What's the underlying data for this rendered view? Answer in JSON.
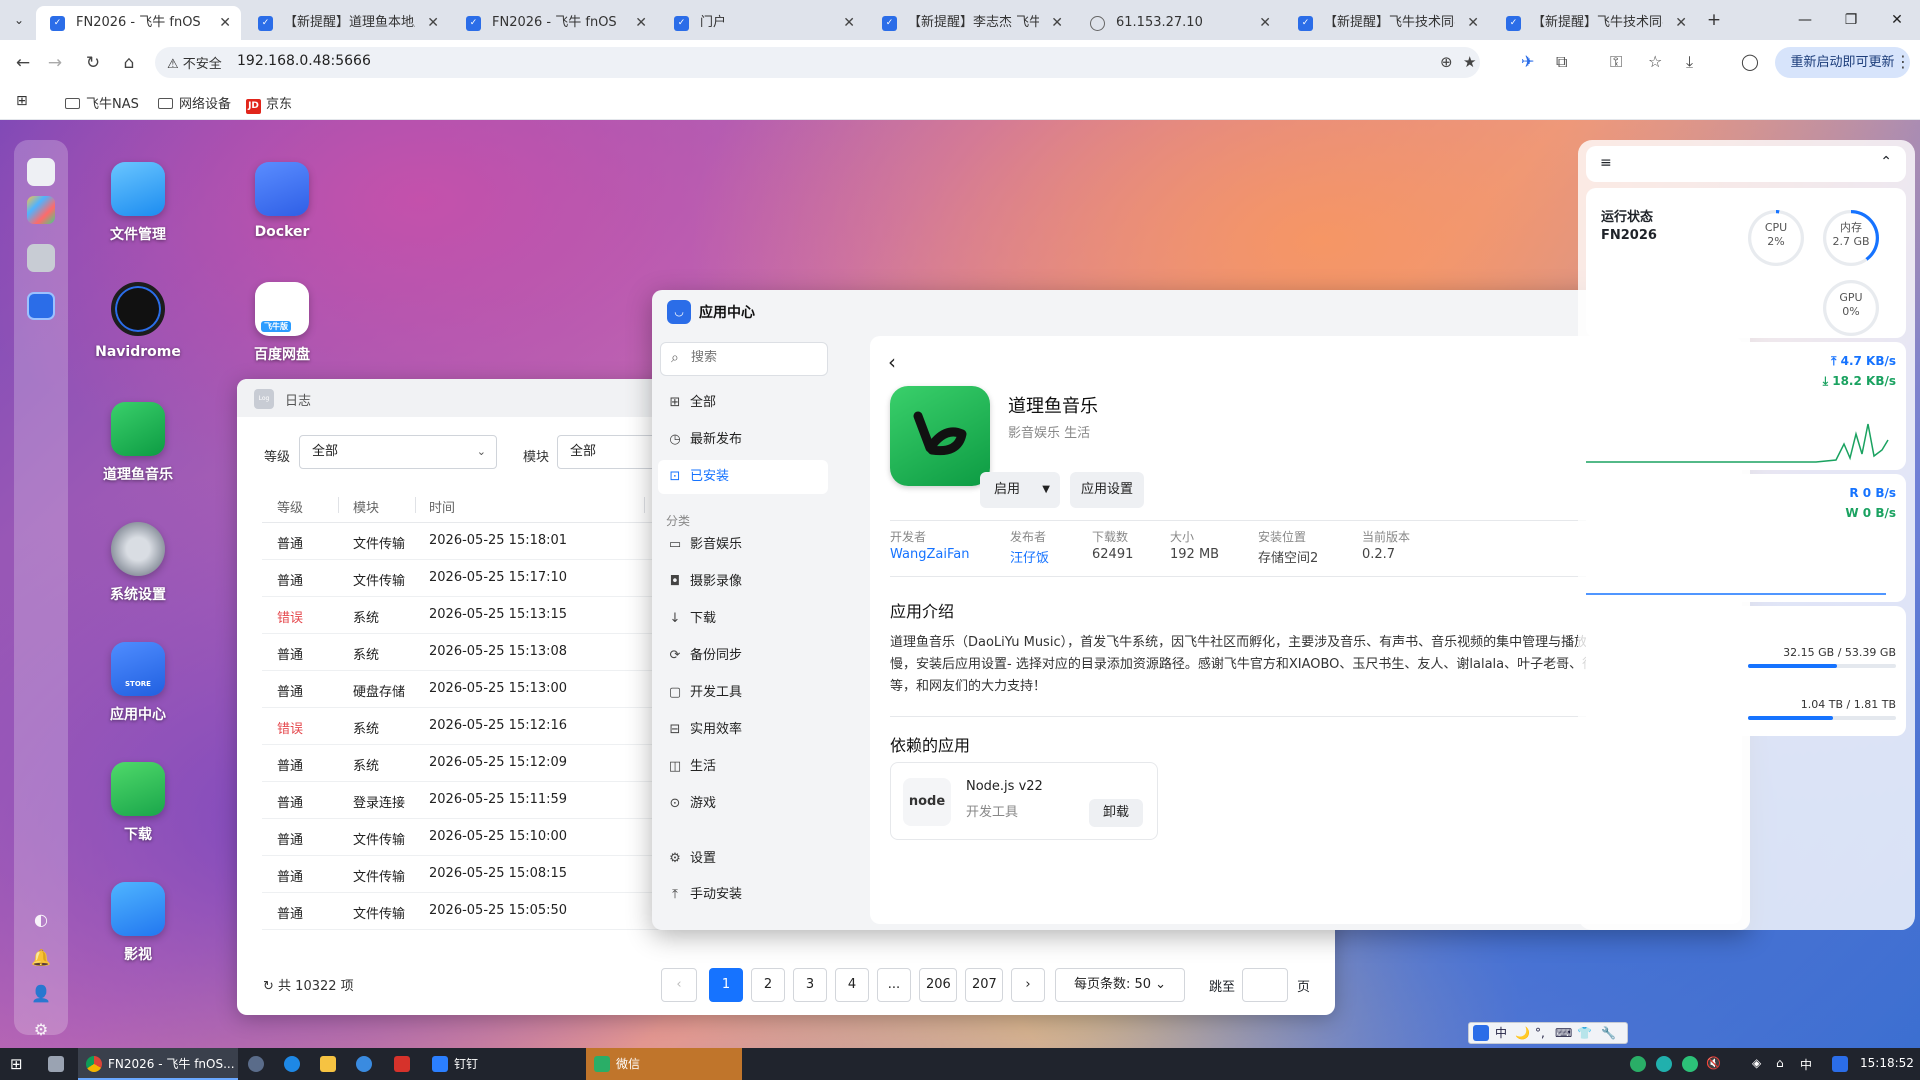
{
  "browser": {
    "tabs": [
      {
        "title": "FN2026 - 飞牛 fnOS",
        "active": true
      },
      {
        "title": "【新提醒】道理鱼本地应...",
        "active": false
      },
      {
        "title": "FN2026 - 飞牛 fnOS",
        "active": false
      },
      {
        "title": "门户",
        "active": false
      },
      {
        "title": "【新提醒】李志杰 飞牛私...",
        "active": false
      },
      {
        "title": "61.153.27.10",
        "active": false
      },
      {
        "title": "【新提醒】飞牛技术同学...",
        "active": false
      },
      {
        "title": "【新提醒】飞牛技术同学...",
        "active": false
      }
    ],
    "insecure_label": "不安全",
    "url": "192.168.0.48:5666",
    "update_button": "重新启动即可更新",
    "bookmarks": [
      "飞牛NAS",
      "网络设备",
      "京东"
    ],
    "jd_logo": "JD"
  },
  "desktop": {
    "apps": [
      {
        "name": "文件管理"
      },
      {
        "name": "Docker"
      },
      {
        "name": "Navidrome"
      },
      {
        "name": "百度网盘"
      },
      {
        "name": "道理鱼音乐"
      },
      {
        "name": "系统设置"
      },
      {
        "name": "应用中心"
      },
      {
        "name": "下载"
      },
      {
        "name": "影视"
      }
    ],
    "store_icon_text": "STORE",
    "baidu_icon_text": "飞牛版"
  },
  "log_window": {
    "title": "日志",
    "logo_text": "Log",
    "level_label": "等级",
    "level_value": "全部",
    "module_label": "模块",
    "module_value": "全部",
    "columns": [
      "等级",
      "模块",
      "时间"
    ],
    "rows": [
      {
        "level": "普通",
        "module": "文件传输",
        "time": "2026-05-25 15:18:01",
        "error": false
      },
      {
        "level": "普通",
        "module": "文件传输",
        "time": "2026-05-25 15:17:10",
        "error": false
      },
      {
        "level": "错误",
        "module": "系统",
        "time": "2026-05-25 15:13:15",
        "error": true
      },
      {
        "level": "普通",
        "module": "系统",
        "time": "2026-05-25 15:13:08",
        "error": false
      },
      {
        "level": "普通",
        "module": "硬盘存储",
        "time": "2026-05-25 15:13:00",
        "error": false
      },
      {
        "level": "错误",
        "module": "系统",
        "time": "2026-05-25 15:12:16",
        "error": true
      },
      {
        "level": "普通",
        "module": "系统",
        "time": "2026-05-25 15:12:09",
        "error": false
      },
      {
        "level": "普通",
        "module": "登录连接",
        "time": "2026-05-25 15:11:59",
        "error": false
      },
      {
        "level": "普通",
        "module": "文件传输",
        "time": "2026-05-25 15:10:00",
        "error": false
      },
      {
        "level": "普通",
        "module": "文件传输",
        "time": "2026-05-25 15:08:15",
        "error": false
      },
      {
        "level": "普通",
        "module": "文件传输",
        "time": "2026-05-25 15:05:50",
        "error": false
      }
    ],
    "total_label": "共 10322 项",
    "pages": [
      "1",
      "2",
      "3",
      "4",
      "...",
      "206",
      "207"
    ],
    "current_page": "1",
    "page_size_label": "每页条数: 50",
    "jump_label": "跳至",
    "jump_value": "",
    "page_unit": "页"
  },
  "app_center": {
    "title": "应用中心",
    "search_placeholder": "搜索",
    "nav": [
      "全部",
      "最新发布",
      "已安装"
    ],
    "active_nav": "已安装",
    "category_title": "分类",
    "categories": [
      "影音娱乐",
      "摄影录像",
      "下载",
      "备份同步",
      "开发工具",
      "实用效率",
      "生活",
      "游戏"
    ],
    "bottom_nav": [
      "设置",
      "手动安装"
    ],
    "app": {
      "name": "道理鱼音乐",
      "category": "影音娱乐 生活",
      "launch_button": "启用",
      "settings_button": "应用设置",
      "meta": [
        {
          "label": "开发者",
          "value": "WangZaiFan",
          "link": true
        },
        {
          "label": "发布者",
          "value": "汪仔饭",
          "link": true
        },
        {
          "label": "下载数",
          "value": "62491",
          "link": false
        },
        {
          "label": "大小",
          "value": "192 MB",
          "link": false
        },
        {
          "label": "安装位置",
          "value": "存储空间2",
          "link": false
        },
        {
          "label": "当前版本",
          "value": "0.2.7",
          "link": false
        }
      ],
      "intro_title": "应用介绍",
      "intro": "道理鱼音乐（DaoLiYu Music），首发飞牛系统，因飞牛社区而孵化，主要涉及音乐、有声书、音乐视频的集中管理与播放，首次安装启动有点慢，安装后应用设置- 选择对应的目录添加资源路径。感谢飞牛官方和XIAOBO、玉尺书生、友人、谢lalala、叶子老哥、徐大大、时也命也、bf等，和网友们的大力支持！",
      "deps_title": "依赖的应用",
      "dependency": {
        "name": "Node.js v22",
        "category": "开发工具",
        "action": "卸载",
        "icon_text": "node"
      }
    }
  },
  "widget": {
    "status_title": "运行状态",
    "device_name": "FN2026",
    "cpu_label": "CPU",
    "cpu_value": "2%",
    "cpu_fraction": 0.02,
    "mem_label": "内存",
    "mem_value": "2.7 GB",
    "mem_fraction": 0.4,
    "gpu_label": "GPU",
    "gpu_value": "0%",
    "gpu_fraction": 0,
    "upload_speed": "4.7 KB/s",
    "download_speed": "18.2 KB/s",
    "disk_read": "R 0 B/s",
    "disk_write": "W 0 B/s",
    "storage1": "32.15 GB / 53.39 GB",
    "storage1_fraction": 0.6,
    "storage2": "1.04 TB / 1.81 TB",
    "storage2_fraction": 0.575
  },
  "ime": [
    "中",
    "🌙",
    "°,",
    "⌨",
    "👕",
    "🔧"
  ],
  "taskbar": {
    "items": [
      "FN2026 - 飞牛 fnOS...",
      "钉钉",
      "微信"
    ],
    "time": "15:18:52",
    "tray": [
      "中"
    ]
  },
  "colors": {
    "accent": "#1673ff",
    "error": "#e5484d",
    "app_green": "#16a34a"
  }
}
